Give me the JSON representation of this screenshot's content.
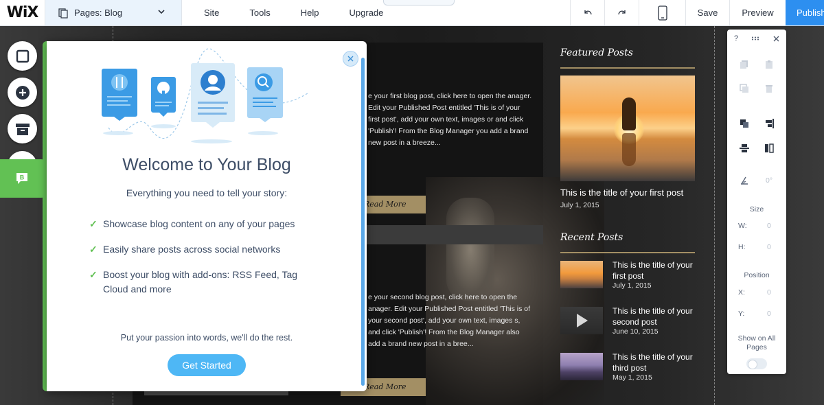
{
  "app": {
    "logo": "WiX",
    "pages_label": "Pages: Blog"
  },
  "menu": {
    "items": [
      "Site",
      "Tools",
      "Help",
      "Upgrade"
    ]
  },
  "toolbar": {
    "undo_icon": "undo-icon",
    "redo_icon": "redo-icon",
    "mobile_icon": "mobile-icon",
    "save_label": "Save",
    "preview_label": "Preview",
    "publish_label": "Publish"
  },
  "rail": {
    "icons": [
      "background-icon",
      "add-icon",
      "media-icon",
      "upload-icon",
      "blog-icon"
    ],
    "blog_letter": "B"
  },
  "modal": {
    "title": "Welcome to Your Blog",
    "subtitle": "Everything you need to tell your story:",
    "features": [
      "Showcase blog content on any of your pages",
      "Easily share posts across social networks",
      "Boost your blog with add-ons: RSS Feed, Tag Cloud and more"
    ],
    "tagline": "Put your passion into words, we'll do the rest.",
    "cta_label": "Get Started",
    "check_glyph": "✓",
    "close_icon": "close-icon"
  },
  "site": {
    "posts": [
      {
        "excerpt": "e your first blog post, click here to open the anager.  Edit your Published Post entitled 'This is of your first post', add your own text, images or and click 'Publish'! From the Blog Manager you add a brand new post in a breeze...",
        "read_more": "Read More"
      },
      {
        "excerpt": "e your second blog post, click here to open the anager.  Edit your Published Post entitled 'This is of your second post', add your own text, images s, and click 'Publish'! From the Blog Manager also add a brand new post in a bree...",
        "read_more": "Read More"
      }
    ],
    "featured_heading": "Featured Posts",
    "featured": {
      "title": "This is the title of your first post",
      "date": "July 1, 2015"
    },
    "recent_heading": "Recent Posts",
    "recent": [
      {
        "title": "This is the title of your first post",
        "date": "July 1, 2015"
      },
      {
        "title": "This is the title of your second post",
        "date": "June 10, 2015"
      },
      {
        "title": "This is the title of your third post",
        "date": "May 1, 2015"
      }
    ]
  },
  "panel": {
    "help": "?",
    "size_label": "Size",
    "w_label": "W:",
    "w_value": "0",
    "h_label": "H:",
    "h_value": "0",
    "position_label": "Position",
    "x_label": "X:",
    "x_value": "0",
    "y_label": "Y:",
    "y_value": "0",
    "rotation_value": "0°",
    "show_all_label": "Show on All Pages"
  }
}
